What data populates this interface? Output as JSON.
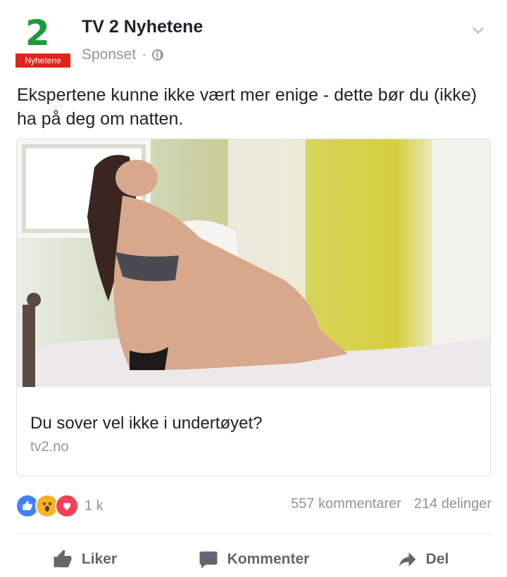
{
  "page": {
    "logo_number": "2",
    "logo_tag": "Nyhetene",
    "name": "TV 2 Nyhetene",
    "sponsored_label": "Sponset",
    "separator": "·"
  },
  "post": {
    "text": "Ekspertene kunne ikke vært mer enige - dette bør du (ikke) ha på deg om natten."
  },
  "link_card": {
    "title": "Du sover vel ikke i undertøyet?",
    "domain": "tv2.no"
  },
  "engagement": {
    "reaction_count": "1 k",
    "comments": "557 kommentarer",
    "shares": "214 delinger",
    "reaction_icons": [
      "like-icon",
      "wow-icon",
      "love-icon"
    ]
  },
  "actions": {
    "like": "Liker",
    "comment": "Kommenter",
    "share": "Del"
  },
  "colors": {
    "like_blue": "#4080ff",
    "wow_yellow": "#f7b125",
    "love_red": "#f33e58",
    "tv2_red": "#e0241b",
    "tv2_green": "#1f9a3a",
    "muted_text": "#90949c"
  }
}
